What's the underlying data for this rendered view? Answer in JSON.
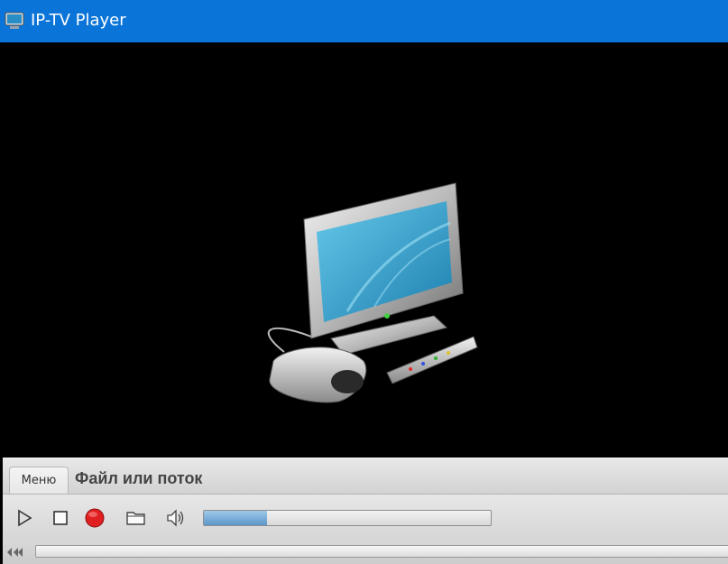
{
  "window": {
    "title": "IP-TV Player"
  },
  "tabs": {
    "menu_label": "Меню",
    "file_label": "Файл или поток"
  },
  "controls": {
    "play": "play-icon",
    "stop": "stop-icon",
    "record": "record-icon",
    "open": "folder-icon",
    "volume": "speaker-icon",
    "volume_level": 0.22
  },
  "seek": {
    "icon": "rewind-icon",
    "position": 0
  },
  "colors": {
    "titlebar": "#0a74d8",
    "record": "#e02020",
    "volume_fill": "#5d97c9"
  }
}
